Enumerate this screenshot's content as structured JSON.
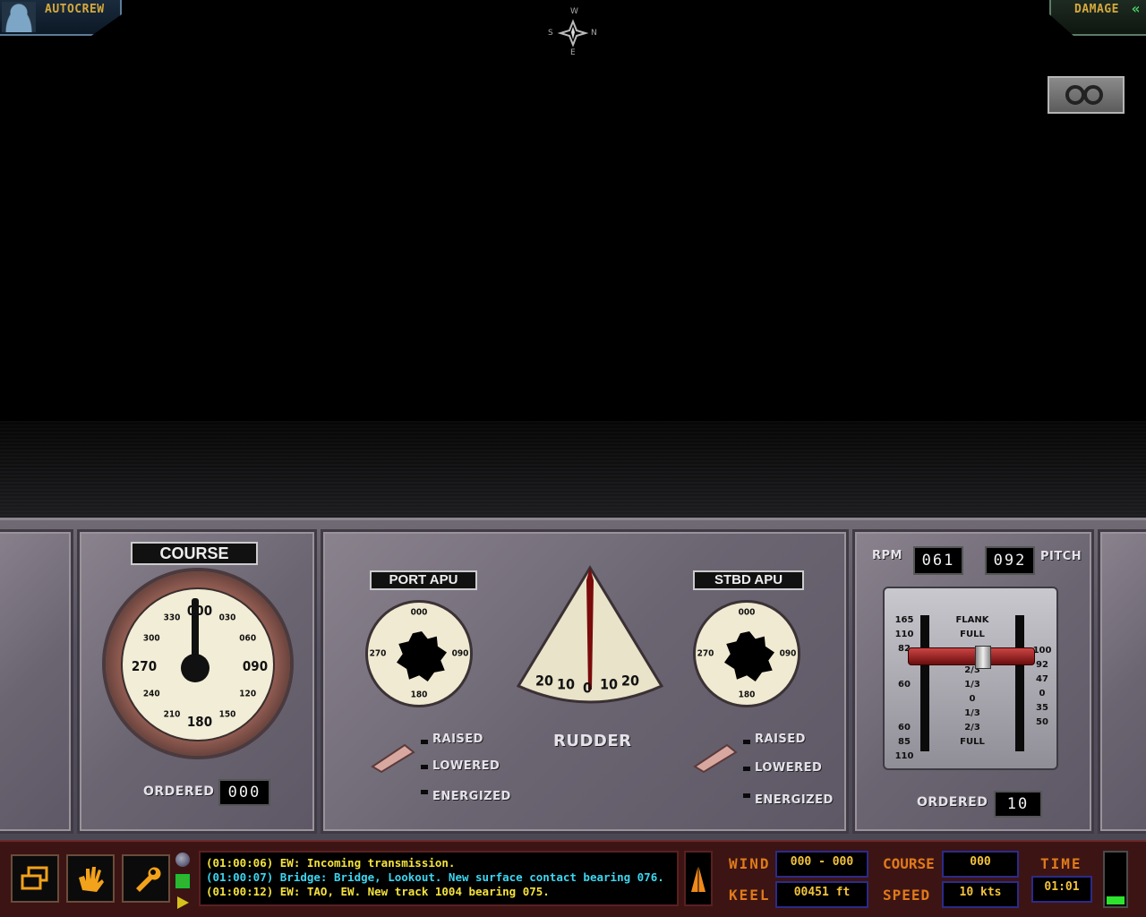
{
  "hud": {
    "autocrew_label": "AUTOCREW",
    "damage_label": "DAMAGE",
    "compass": {
      "n": "N",
      "e": "E",
      "s": "S",
      "w": "W"
    }
  },
  "course_panel": {
    "title": "COURSE",
    "dial_numbers": [
      "000",
      "030",
      "060",
      "090",
      "120",
      "150",
      "180",
      "210",
      "240",
      "270",
      "300",
      "330"
    ],
    "ordered_label": "ORDERED",
    "ordered_value": "000"
  },
  "port_apu": {
    "title": "PORT APU",
    "dial_numbers": [
      "000",
      "090",
      "180",
      "270"
    ],
    "states": [
      "RAISED",
      "LOWERED",
      "ENERGIZED"
    ]
  },
  "rudder": {
    "label": "RUDDER",
    "scale": [
      "20",
      "10",
      "0",
      "10",
      "20"
    ]
  },
  "stbd_apu": {
    "title": "STBD APU",
    "dial_numbers": [
      "000",
      "090",
      "180",
      "270"
    ],
    "states": [
      "RAISED",
      "LOWERED",
      "ENERGIZED"
    ]
  },
  "engine": {
    "rpm_label": "RPM",
    "rpm_value": "061",
    "pitch_label": "PITCH",
    "pitch_value": "092",
    "telegraph_center": [
      "FLANK",
      "FULL",
      "2/3",
      "1/3",
      "0",
      "1/3",
      "2/3",
      "FULL"
    ],
    "telegraph_left": [
      "165",
      "110",
      "82",
      "60",
      "",
      "",
      "60",
      "85",
      "110"
    ],
    "telegraph_right": [
      "100",
      "92",
      "47",
      "0",
      "35",
      "50"
    ],
    "ordered_label": "ORDERED",
    "ordered_value": "10"
  },
  "log": [
    {
      "text": "(01:00:06) EW: Incoming transmission.",
      "color": "#f5e23c"
    },
    {
      "text": "(01:00:07) Bridge: Bridge, Lookout. New surface contact bearing 076.",
      "color": "#3cd6f0"
    },
    {
      "text": "(01:00:12) EW: TAO, EW. New track 1004 bearing 075.",
      "color": "#f5e23c"
    }
  ],
  "nav": {
    "wind_label": "WIND",
    "wind_value": "000 - 000",
    "keel_label": "KEEL",
    "keel_value": "00451 ft",
    "course_label": "COURSE",
    "course_value": "000",
    "speed_label": "SPEED",
    "speed_value": "10  kts",
    "time_label": "TIME",
    "time_value": "01:01",
    "time_bar_level": 0.15
  },
  "colors": {
    "hud_gold": "#d6a93c",
    "button_orange": "#f3a21b",
    "log_yellow": "#f5e23c",
    "log_cyan": "#3cd6f0",
    "nav_orange": "#e07a1a"
  },
  "icons": {
    "windows_button": "windows-icon",
    "alarm_button": "hand-alert-icon",
    "repair_button": "wrench-icon"
  }
}
